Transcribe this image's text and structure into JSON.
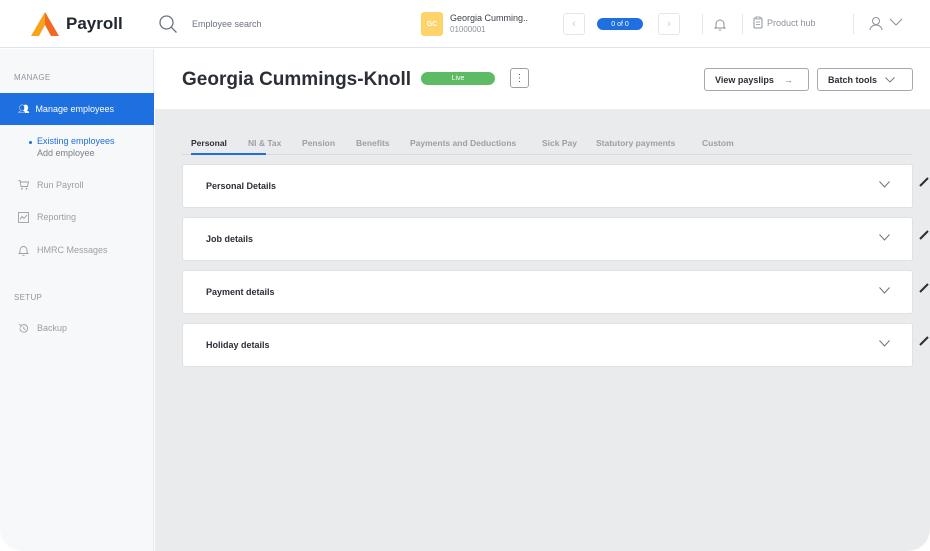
{
  "app": {
    "name": "Payroll"
  },
  "search": {
    "placeholder": "Employee search"
  },
  "employee_switcher": {
    "initials": "GC",
    "name": "Georgia Cumming..",
    "id": "01000001",
    "counter": "0 of 0"
  },
  "header_right": {
    "product_hub": "Product hub"
  },
  "sidebar": {
    "section_manage": "MANAGE",
    "manage_employees": "Manage employees",
    "sub_existing": "Existing employees",
    "sub_add": "Add employee",
    "run_payroll": "Run Payroll",
    "reporting": "Reporting",
    "hmrc": "HMRC Messages",
    "section_setup": "SETUP",
    "backup": "Backup"
  },
  "page": {
    "title": "Georgia Cummings-Knoll",
    "status": "Live",
    "kebab": "⋮",
    "view_payslips": "View payslips",
    "view_payslips_arrow": "→",
    "batch_tools": "Batch tools"
  },
  "tabs": [
    "Personal",
    "NI & Tax",
    "Pension",
    "Benefits",
    "Payments and Deductions",
    "Sick Pay",
    "Statutory payments",
    "Custom"
  ],
  "sections": [
    "Personal Details",
    "Job details",
    "Payment details",
    "Holiday details"
  ],
  "colors": {
    "accent": "#1e6fe0",
    "live": "#5dbb63",
    "avatar": "#ffd36b",
    "logo_orange": "#f26a21"
  }
}
